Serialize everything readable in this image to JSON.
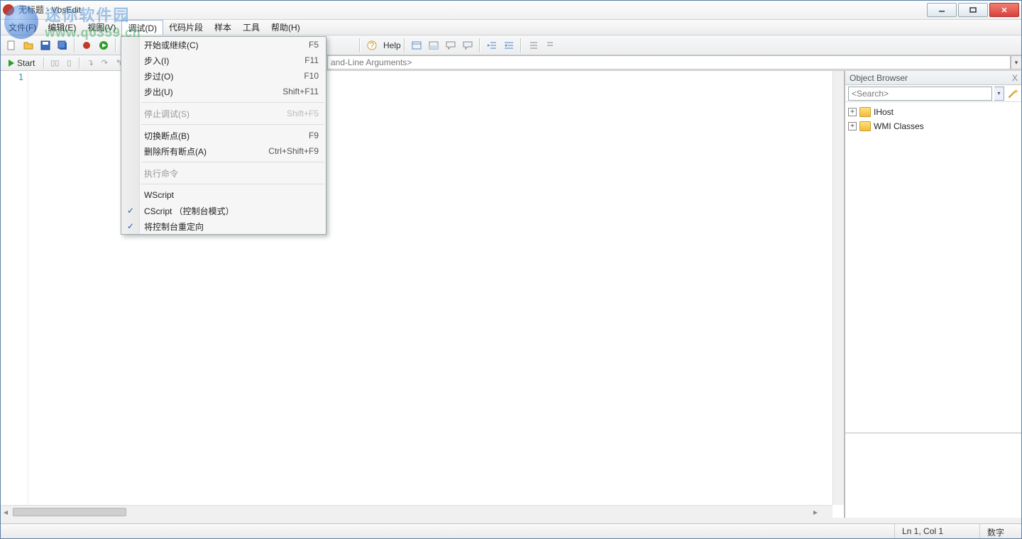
{
  "title": "无标题 - VbsEdit",
  "watermark": {
    "cn": "迷你软件园",
    "url": "www.q0359.cn"
  },
  "menu": {
    "items": [
      "文件(F)",
      "编辑(E)",
      "视图(V)",
      "调试(D)",
      "代码片段",
      "样本",
      "工具",
      "帮助(H)"
    ],
    "activeIndex": 3
  },
  "toolbar": {
    "help_label": "Help"
  },
  "start_label": "Start",
  "args_placeholder": "and-Line Arguments>",
  "gutter": {
    "line1": "1"
  },
  "dropdown": {
    "items": [
      {
        "label": "开始或继续(C)",
        "shortcut": "F5",
        "type": "item"
      },
      {
        "label": "步入(I)",
        "shortcut": "F11",
        "type": "item"
      },
      {
        "label": "步过(O)",
        "shortcut": "F10",
        "type": "item"
      },
      {
        "label": "步出(U)",
        "shortcut": "Shift+F11",
        "type": "item"
      },
      {
        "type": "sep"
      },
      {
        "label": "停止调试(S)",
        "shortcut": "Shift+F5",
        "type": "item",
        "disabled": true
      },
      {
        "type": "sep"
      },
      {
        "label": "切换断点(B)",
        "shortcut": "F9",
        "type": "item"
      },
      {
        "label": "删除所有断点(A)",
        "shortcut": "Ctrl+Shift+F9",
        "type": "item"
      },
      {
        "type": "sep"
      },
      {
        "label": "执行命令",
        "type": "item",
        "disabled": true
      },
      {
        "type": "sep"
      },
      {
        "label": "WScript",
        "type": "item"
      },
      {
        "label": "CScript （控制台模式）",
        "type": "item",
        "checked": true
      },
      {
        "label": "将控制台重定向",
        "type": "item",
        "checked": true
      }
    ]
  },
  "objectBrowser": {
    "title": "Object Browser",
    "search_placeholder": "<Search>",
    "tree": [
      {
        "label": "IHost"
      },
      {
        "label": "WMI Classes"
      }
    ]
  },
  "status": {
    "pos": "Ln 1, Col 1",
    "mode": "数字"
  }
}
